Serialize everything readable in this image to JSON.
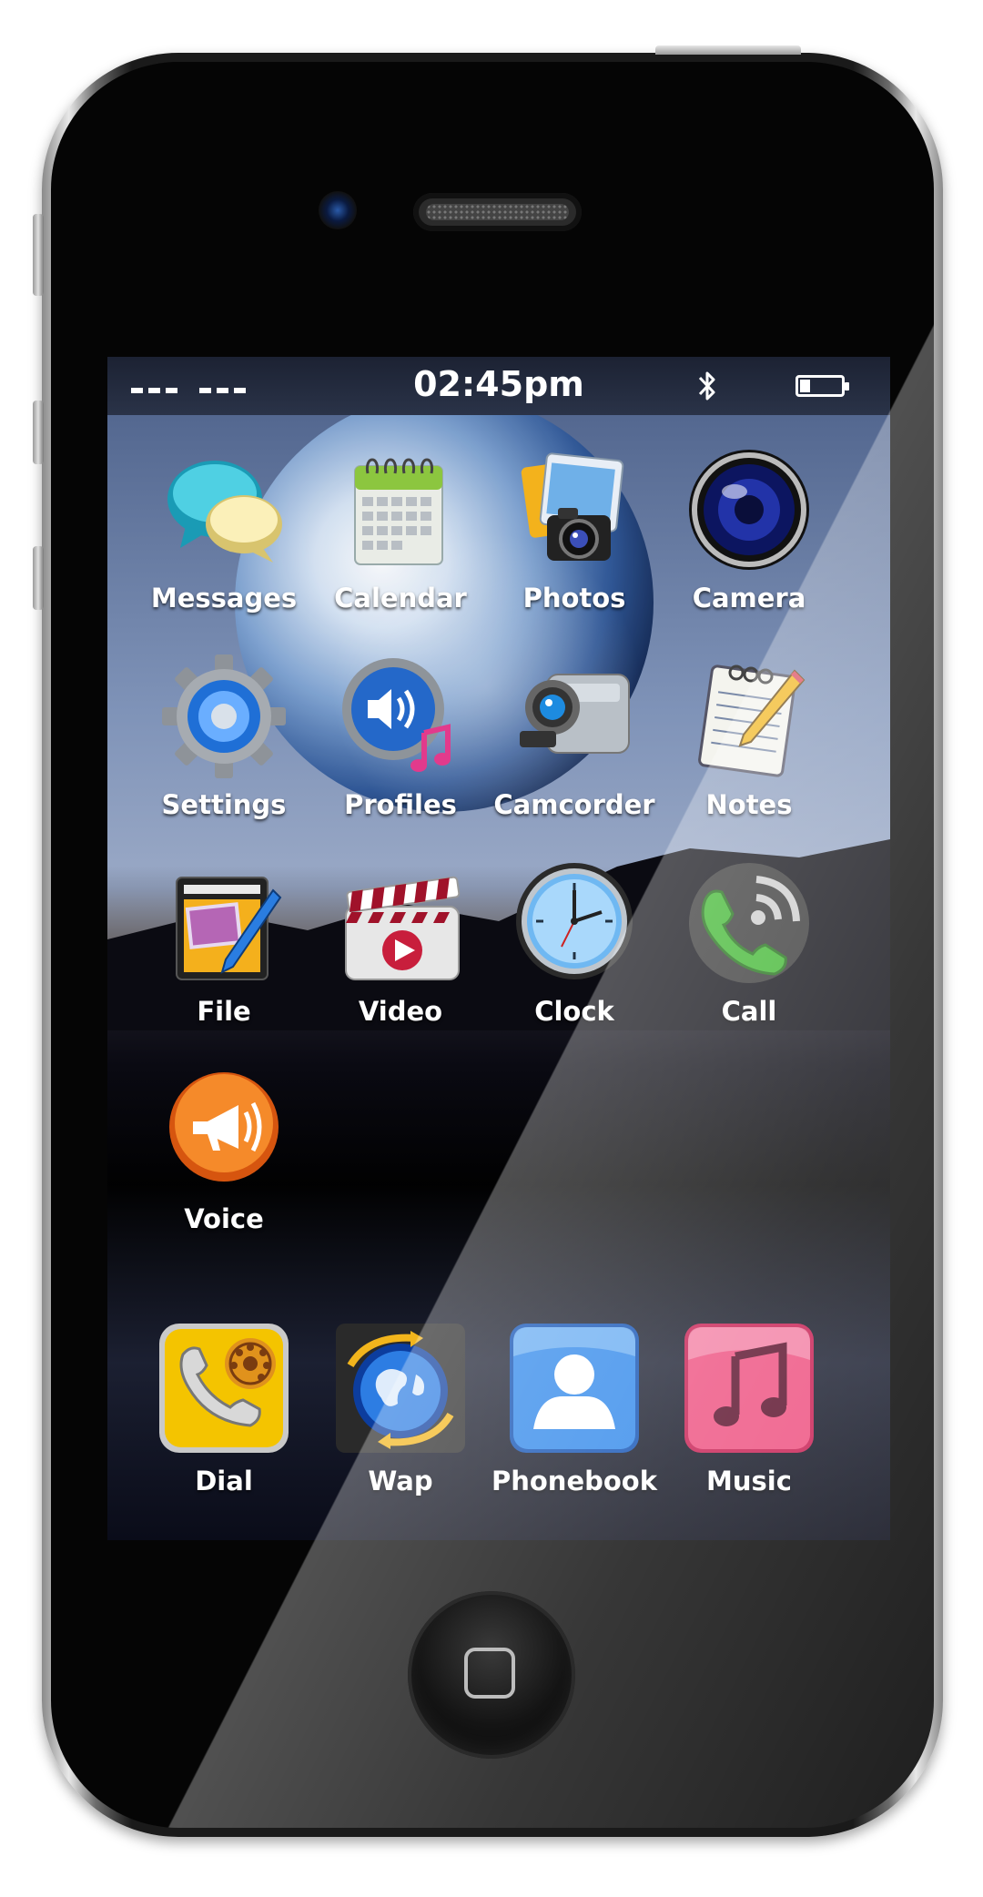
{
  "status_bar": {
    "time": "02:45pm",
    "icons": [
      "signal-bars-icon",
      "bluetooth-icon",
      "battery-icon"
    ],
    "battery_level": 0.25
  },
  "apps": [
    {
      "label": "Messages",
      "icon": "messages-icon"
    },
    {
      "label": "Calendar",
      "icon": "calendar-icon"
    },
    {
      "label": "Photos",
      "icon": "photos-icon"
    },
    {
      "label": "Camera",
      "icon": "camera-icon"
    },
    {
      "label": "Settings",
      "icon": "settings-gear-icon"
    },
    {
      "label": "Profiles",
      "icon": "profiles-speaker-icon"
    },
    {
      "label": "Camcorder",
      "icon": "camcorder-icon"
    },
    {
      "label": "Notes",
      "icon": "notes-notepad-icon"
    },
    {
      "label": "File",
      "icon": "file-icon"
    },
    {
      "label": "Video",
      "icon": "video-clapperboard-icon"
    },
    {
      "label": "Clock",
      "icon": "clock-icon"
    },
    {
      "label": "Call",
      "icon": "call-phone-icon"
    },
    {
      "label": "Voice",
      "icon": "voice-megaphone-icon"
    }
  ],
  "dock": [
    {
      "label": "Dial",
      "icon": "dial-rotary-phone-icon"
    },
    {
      "label": "Wap",
      "icon": "wap-globe-icon"
    },
    {
      "label": "Phonebook",
      "icon": "phonebook-contact-icon"
    },
    {
      "label": "Music",
      "icon": "music-note-icon"
    }
  ],
  "colors": {
    "status_bar_bg": "#1c2233",
    "label_text": "#ffffff",
    "dial_yellow": "#f4c400",
    "phonebook_blue": "#1f6fd6",
    "music_pink": "#e8336b",
    "voice_orange": "#f0741e"
  }
}
